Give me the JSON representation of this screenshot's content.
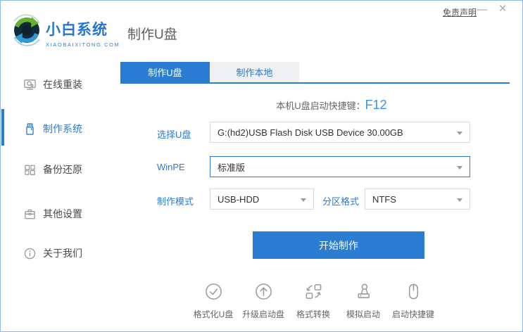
{
  "window": {
    "disclaimer": "免责声明",
    "minimize": "—",
    "close": "×"
  },
  "header": {
    "brand_name": "小白系统",
    "brand_domain": "XIAOBAIXITONG.COM",
    "page_title": "制作U盘"
  },
  "sidebar": {
    "items": [
      {
        "label": "在线重装",
        "icon": "monitor-icon",
        "active": false
      },
      {
        "label": "制作系统",
        "icon": "usb-drive-icon",
        "active": true
      },
      {
        "label": "备份还原",
        "icon": "backup-grid-icon",
        "active": false
      },
      {
        "label": "其他设置",
        "icon": "briefcase-icon",
        "active": false
      },
      {
        "label": "关于我们",
        "icon": "info-icon",
        "active": false
      }
    ]
  },
  "tabs": [
    {
      "label": "制作U盘",
      "active": true
    },
    {
      "label": "制作本地",
      "active": false
    }
  ],
  "main": {
    "hotkey_label": "本机U盘启动快捷键：",
    "hotkey_value": "F12",
    "form": {
      "usb_label": "选择U盘",
      "usb_value": "G:(hd2)USB Flash Disk USB Device 30.00GB",
      "winpe_label": "WinPE",
      "winpe_value": "标准版",
      "mode_label": "制作模式",
      "mode_value": "USB-HDD",
      "partition_label": "分区格式",
      "partition_value": "NTFS"
    },
    "start_button": "开始制作",
    "tools": [
      {
        "label": "格式化U盘",
        "icon": "format-usb-icon"
      },
      {
        "label": "升级启动盘",
        "icon": "upgrade-boot-icon"
      },
      {
        "label": "格式转换",
        "icon": "format-convert-icon"
      },
      {
        "label": "模拟启动",
        "icon": "simulate-boot-icon"
      },
      {
        "label": "启动快捷键",
        "icon": "boot-hotkey-icon"
      }
    ]
  },
  "colors": {
    "primary": "#2b7dd4",
    "hotkey_blue": "#3794e8",
    "border_blue": "#8fb9e8"
  }
}
